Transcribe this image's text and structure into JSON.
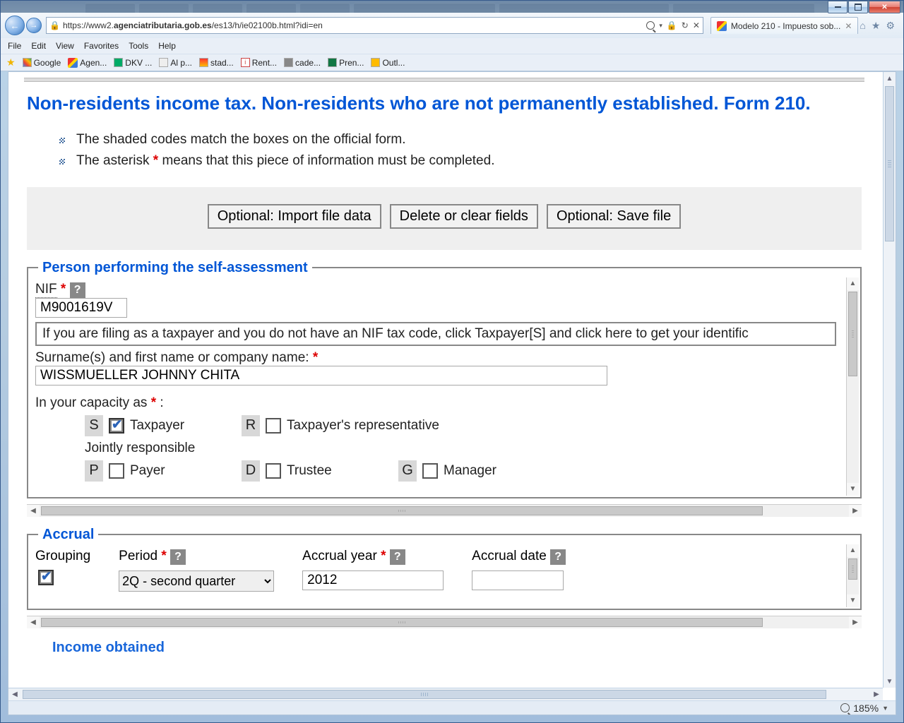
{
  "browser": {
    "url_prefix": "https://www2.",
    "url_host": "agenciatributaria.gob.es",
    "url_path": "/es13/h/ie02100b.html?idi=en",
    "tab_title": "Modelo 210 - Impuesto sob...",
    "menus": [
      "File",
      "Edit",
      "View",
      "Favorites",
      "Tools",
      "Help"
    ],
    "favorites": [
      "Google",
      "Agen...",
      "DKV ...",
      "Al p...",
      "stad...",
      "Rent...",
      "cade...",
      "Pren...",
      "Outl..."
    ]
  },
  "page": {
    "title": "Non-residents income tax. Non-residents who are not permanently established. Form 210.",
    "note1_a": "The shaded codes match the boxes on the official form.",
    "note2_a": "The asterisk ",
    "note2_b": " means that this piece of information must be completed.",
    "buttons": {
      "import": "Optional: Import file data",
      "clear": "Delete or clear fields",
      "save": "Optional: Save file"
    }
  },
  "section1": {
    "legend": "Person performing the self-assessment",
    "nif_label": "NIF",
    "nif_value": "M9001619V",
    "nif_hint": "If you are filing as a taxpayer and you do not have an NIF tax code, click Taxpayer[S] and click here to get your identific",
    "name_label": "Surname(s) and first name or company name:",
    "name_value": "WISSMUELLER JOHNNY CHITA",
    "capacity_label": "In your capacity as",
    "joint_label": "Jointly responsible",
    "codes": {
      "s": "S",
      "r": "R",
      "p": "P",
      "d": "D",
      "g": "G"
    },
    "roles": {
      "taxpayer": "Taxpayer",
      "rep": "Taxpayer's representative",
      "payer": "Payer",
      "trustee": "Trustee",
      "manager": "Manager"
    }
  },
  "section2": {
    "legend": "Accrual",
    "grouping_label": "Grouping",
    "period_label": "Period",
    "period_value": "2Q - second quarter",
    "year_label": "Accrual year",
    "year_value": "2012",
    "date_label": "Accrual date",
    "date_value": ""
  },
  "status": {
    "zoom": "185%"
  },
  "truncated_next": "Income obtained"
}
